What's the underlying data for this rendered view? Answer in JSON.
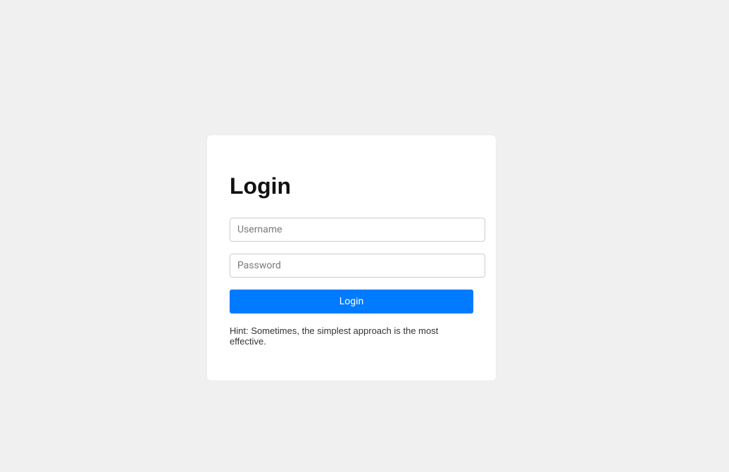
{
  "login": {
    "title": "Login",
    "username_placeholder": "Username",
    "password_placeholder": "Password",
    "button_label": "Login",
    "hint": "Hint: Sometimes, the simplest approach is the most effective."
  }
}
